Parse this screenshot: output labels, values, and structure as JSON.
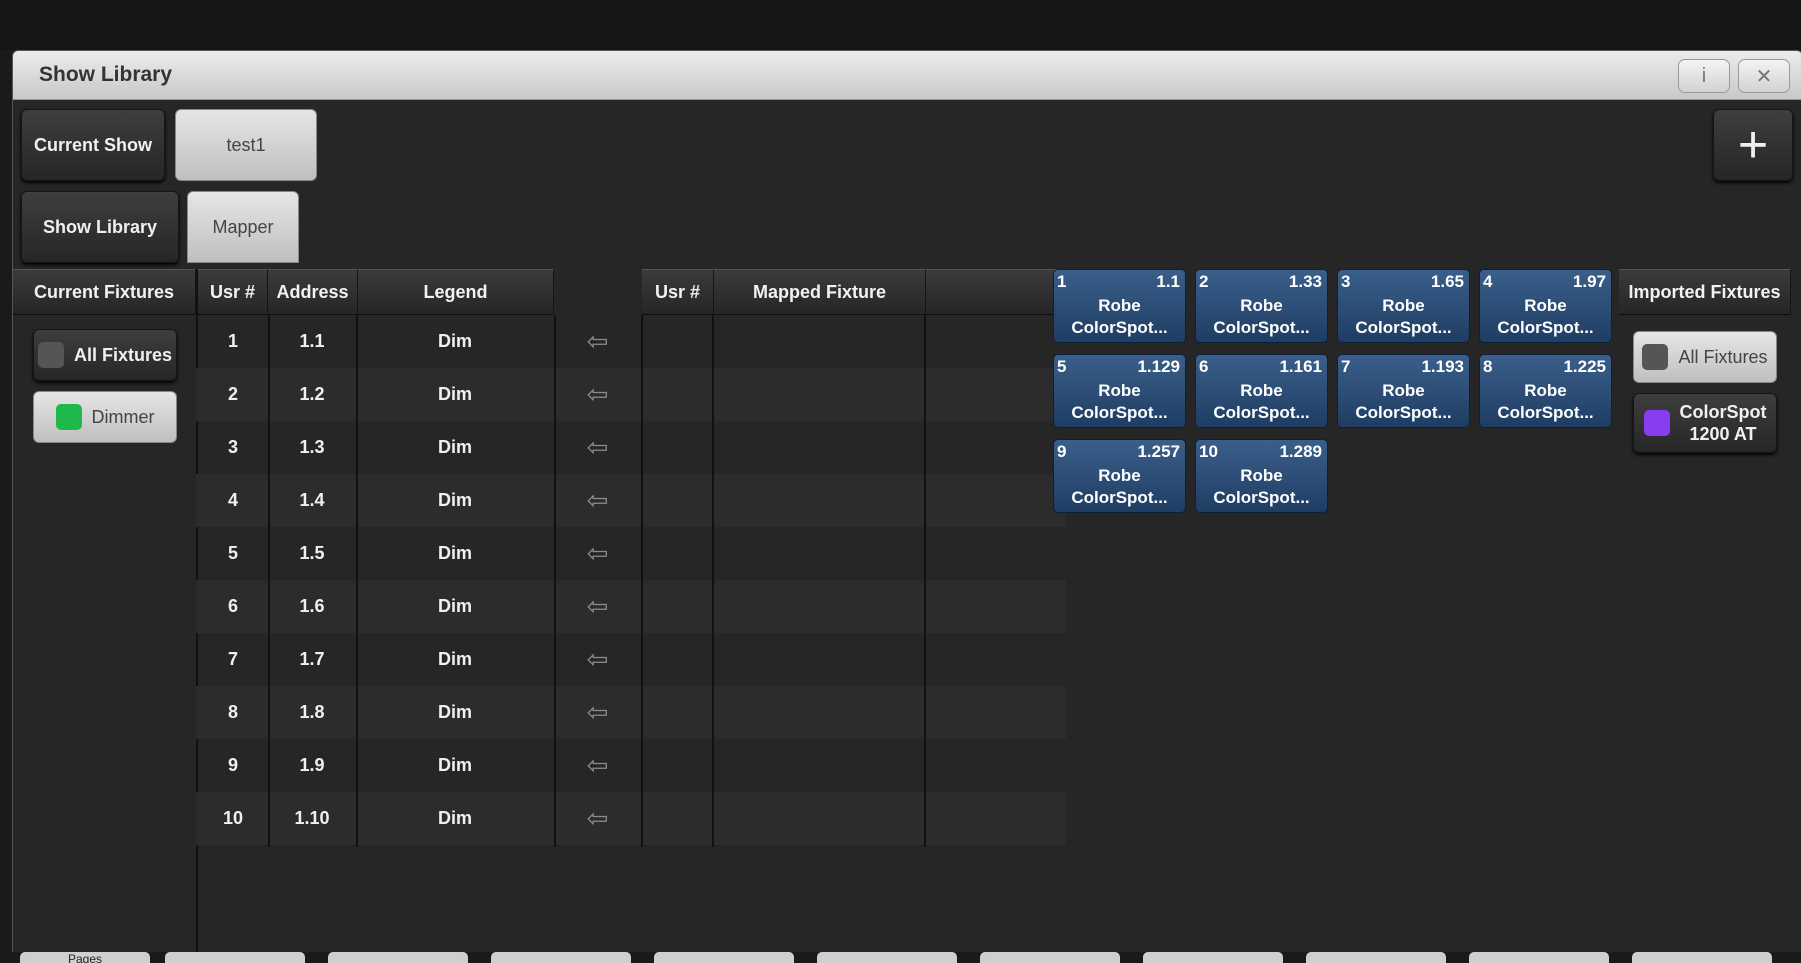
{
  "window": {
    "title": "Show Library",
    "info_icon": "i",
    "close_icon": "✕"
  },
  "current_show": {
    "label": "Current Show",
    "value": "test1"
  },
  "tabs": [
    {
      "label": "Show Library"
    },
    {
      "label": "Mapper"
    }
  ],
  "add_button": {
    "label": "+"
  },
  "current_fixtures": {
    "header": "Current Fixtures",
    "buttons": [
      {
        "label": "All Fixtures",
        "color": "#555555"
      },
      {
        "label": "Dimmer",
        "color": "#1fb84a"
      }
    ]
  },
  "source_table": {
    "columns": [
      "Usr #",
      "Address",
      "Legend"
    ],
    "rows": [
      {
        "usr": "1",
        "address": "1.1",
        "legend": "Dim"
      },
      {
        "usr": "2",
        "address": "1.2",
        "legend": "Dim"
      },
      {
        "usr": "3",
        "address": "1.3",
        "legend": "Dim"
      },
      {
        "usr": "4",
        "address": "1.4",
        "legend": "Dim"
      },
      {
        "usr": "5",
        "address": "1.5",
        "legend": "Dim"
      },
      {
        "usr": "6",
        "address": "1.6",
        "legend": "Dim"
      },
      {
        "usr": "7",
        "address": "1.7",
        "legend": "Dim"
      },
      {
        "usr": "8",
        "address": "1.8",
        "legend": "Dim"
      },
      {
        "usr": "9",
        "address": "1.9",
        "legend": "Dim"
      },
      {
        "usr": "10",
        "address": "1.10",
        "legend": "Dim"
      }
    ],
    "arrow_glyph": "⇦"
  },
  "mapped_table": {
    "columns": [
      "Usr #",
      "Mapped Fixture",
      ""
    ]
  },
  "imported_tiles": [
    {
      "num": "1",
      "addr": "1.1",
      "name": "Robe\nColorSpot..."
    },
    {
      "num": "2",
      "addr": "1.33",
      "name": "Robe\nColorSpot..."
    },
    {
      "num": "3",
      "addr": "1.65",
      "name": "Robe\nColorSpot..."
    },
    {
      "num": "4",
      "addr": "1.97",
      "name": "Robe\nColorSpot..."
    },
    {
      "num": "5",
      "addr": "1.129",
      "name": "Robe\nColorSpot..."
    },
    {
      "num": "6",
      "addr": "1.161",
      "name": "Robe\nColorSpot..."
    },
    {
      "num": "7",
      "addr": "1.193",
      "name": "Robe\nColorSpot..."
    },
    {
      "num": "8",
      "addr": "1.225",
      "name": "Robe\nColorSpot..."
    },
    {
      "num": "9",
      "addr": "1.257",
      "name": "Robe\nColorSpot..."
    },
    {
      "num": "10",
      "addr": "1.289",
      "name": "Robe\nColorSpot..."
    }
  ],
  "imported_fixtures": {
    "header": "Imported Fixtures",
    "buttons": [
      {
        "label": "All Fixtures",
        "color": "#555555"
      },
      {
        "label": "ColorSpot\n1200 AT",
        "color": "#8a3cf0"
      }
    ]
  },
  "bottom_tabs": [
    "Pages",
    "",
    "",
    "",
    "",
    "",
    "",
    "",
    "",
    "",
    ""
  ]
}
